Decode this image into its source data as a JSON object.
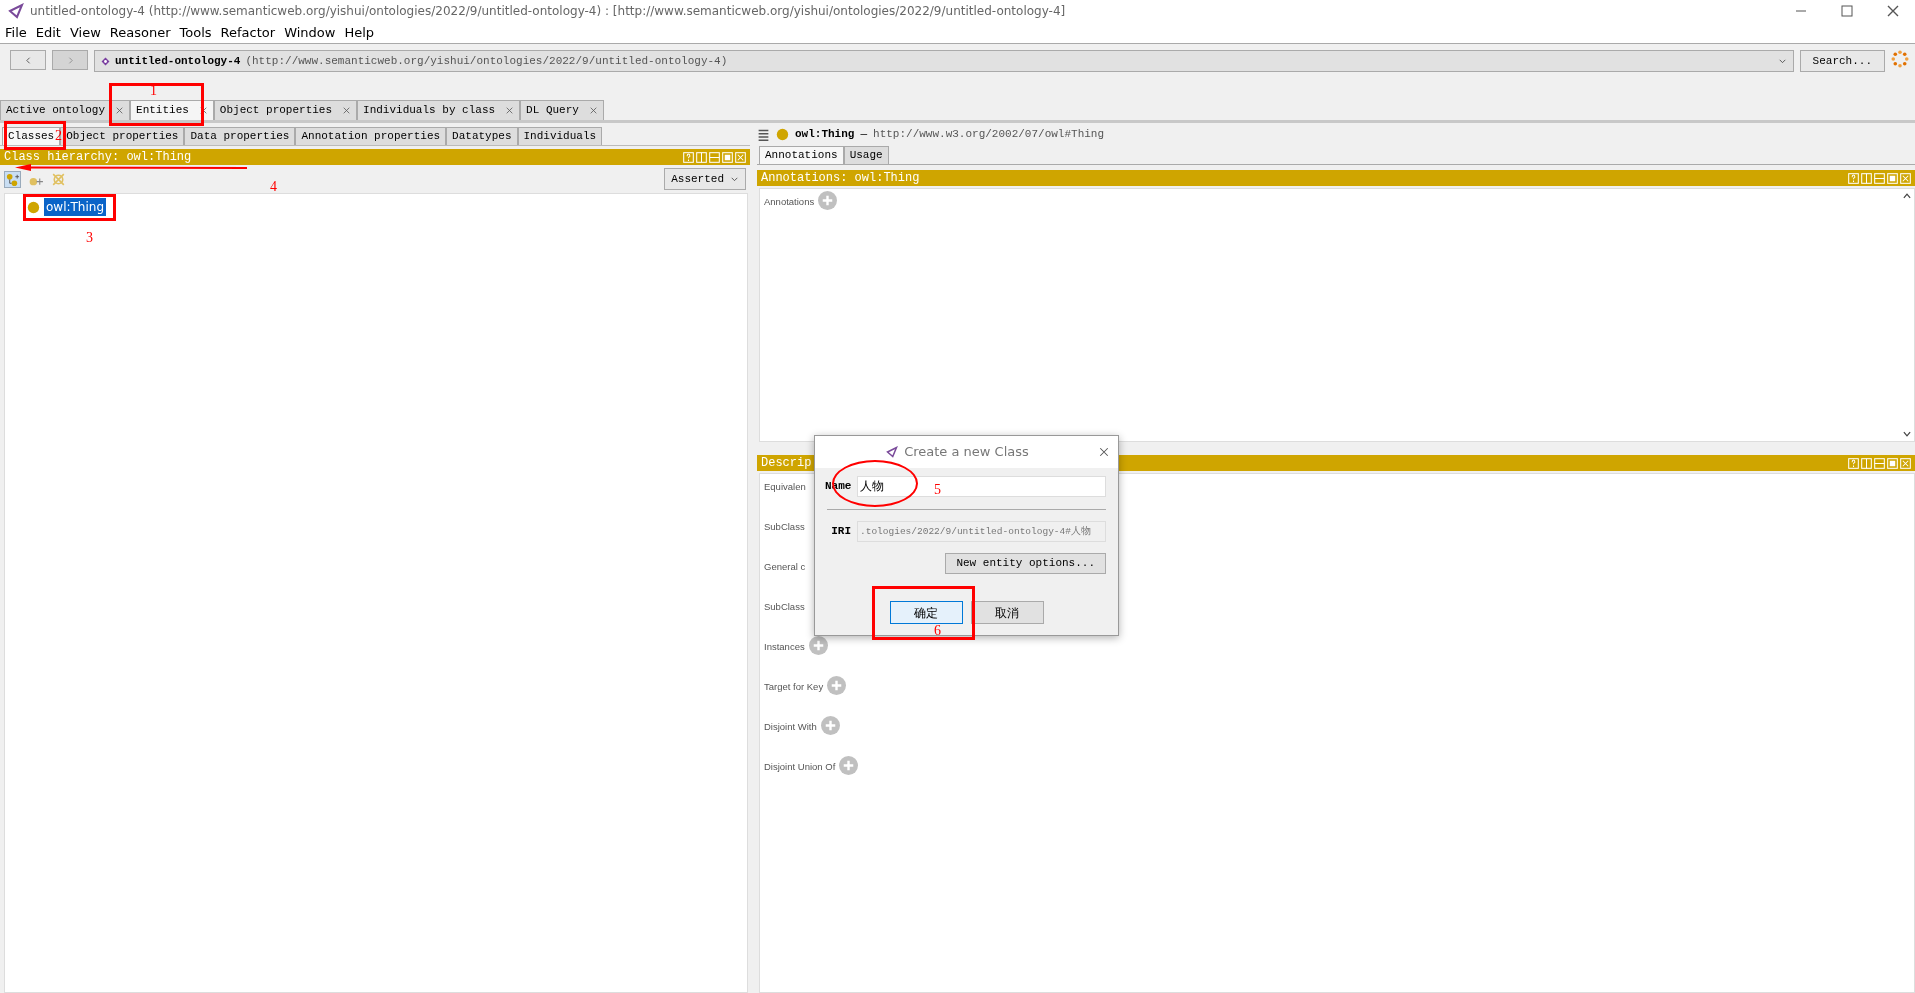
{
  "window": {
    "title": "untitled-ontology-4 (http://www.semanticweb.org/yishui/ontologies/2022/9/untitled-ontology-4)  : [http://www.semanticweb.org/yishui/ontologies/2022/9/untitled-ontology-4]"
  },
  "menu": [
    "File",
    "Edit",
    "View",
    "Reasoner",
    "Tools",
    "Refactor",
    "Window",
    "Help"
  ],
  "toolbar": {
    "ontology_name": "untitled-ontology-4",
    "ontology_iri": "(http://www.semanticweb.org/yishui/ontologies/2022/9/untitled-ontology-4)",
    "search_button": "Search..."
  },
  "main_tabs": [
    {
      "label": "Active ontology",
      "selected": false
    },
    {
      "label": "Entities",
      "selected": true
    },
    {
      "label": "Object properties",
      "selected": false
    },
    {
      "label": "Individuals by class",
      "selected": false
    },
    {
      "label": "DL Query",
      "selected": false
    }
  ],
  "entity_tabs": [
    {
      "label": "Classes",
      "selected": true
    },
    {
      "label": "Object properties",
      "selected": false
    },
    {
      "label": "Data properties",
      "selected": false
    },
    {
      "label": "Annotation properties",
      "selected": false
    },
    {
      "label": "Datatypes",
      "selected": false
    },
    {
      "label": "Individuals",
      "selected": false
    }
  ],
  "class_hierarchy": {
    "title": "Class hierarchy: owl:Thing",
    "view": "Asserted",
    "tree": [
      {
        "label": "owl:Thing",
        "selected": true
      }
    ]
  },
  "entity_header": {
    "name": "owl:Thing",
    "separator": "—",
    "iri": "http://www.w3.org/2002/07/owl#Thing"
  },
  "detail_tabs": [
    {
      "label": "Annotations",
      "selected": true
    },
    {
      "label": "Usage",
      "selected": false
    }
  ],
  "annotations_panel": {
    "title": "Annotations: owl:Thing",
    "sections": [
      {
        "label": "Annotations",
        "add": true
      }
    ]
  },
  "description_panel": {
    "title": "Descrip",
    "sections": [
      {
        "label": "Equivalen",
        "add": false
      },
      {
        "label": "SubClass",
        "add": false
      },
      {
        "label": "General c",
        "add": false
      },
      {
        "label": "SubClass",
        "add": false
      },
      {
        "label": "Instances",
        "add": true
      },
      {
        "label": "Target for Key",
        "add": true
      },
      {
        "label": "Disjoint With",
        "add": true
      },
      {
        "label": "Disjoint Union Of",
        "add": true
      }
    ]
  },
  "dialog": {
    "title": "Create a new Class",
    "name_label": "Name",
    "name_value": "人物",
    "iri_label": "IRI",
    "iri_value": ".tologies/2022/9/untitled-ontology-4#人物",
    "options_button": "New entity options...",
    "ok_button": "确定",
    "cancel_button": "取消"
  },
  "markup": [
    {
      "kind": "box",
      "number": "1"
    },
    {
      "kind": "box",
      "number": "2"
    },
    {
      "kind": "box",
      "number": "3"
    },
    {
      "kind": "arrow",
      "number": "4"
    },
    {
      "kind": "ellipse",
      "number": "5"
    },
    {
      "kind": "box",
      "number": "6"
    }
  ]
}
